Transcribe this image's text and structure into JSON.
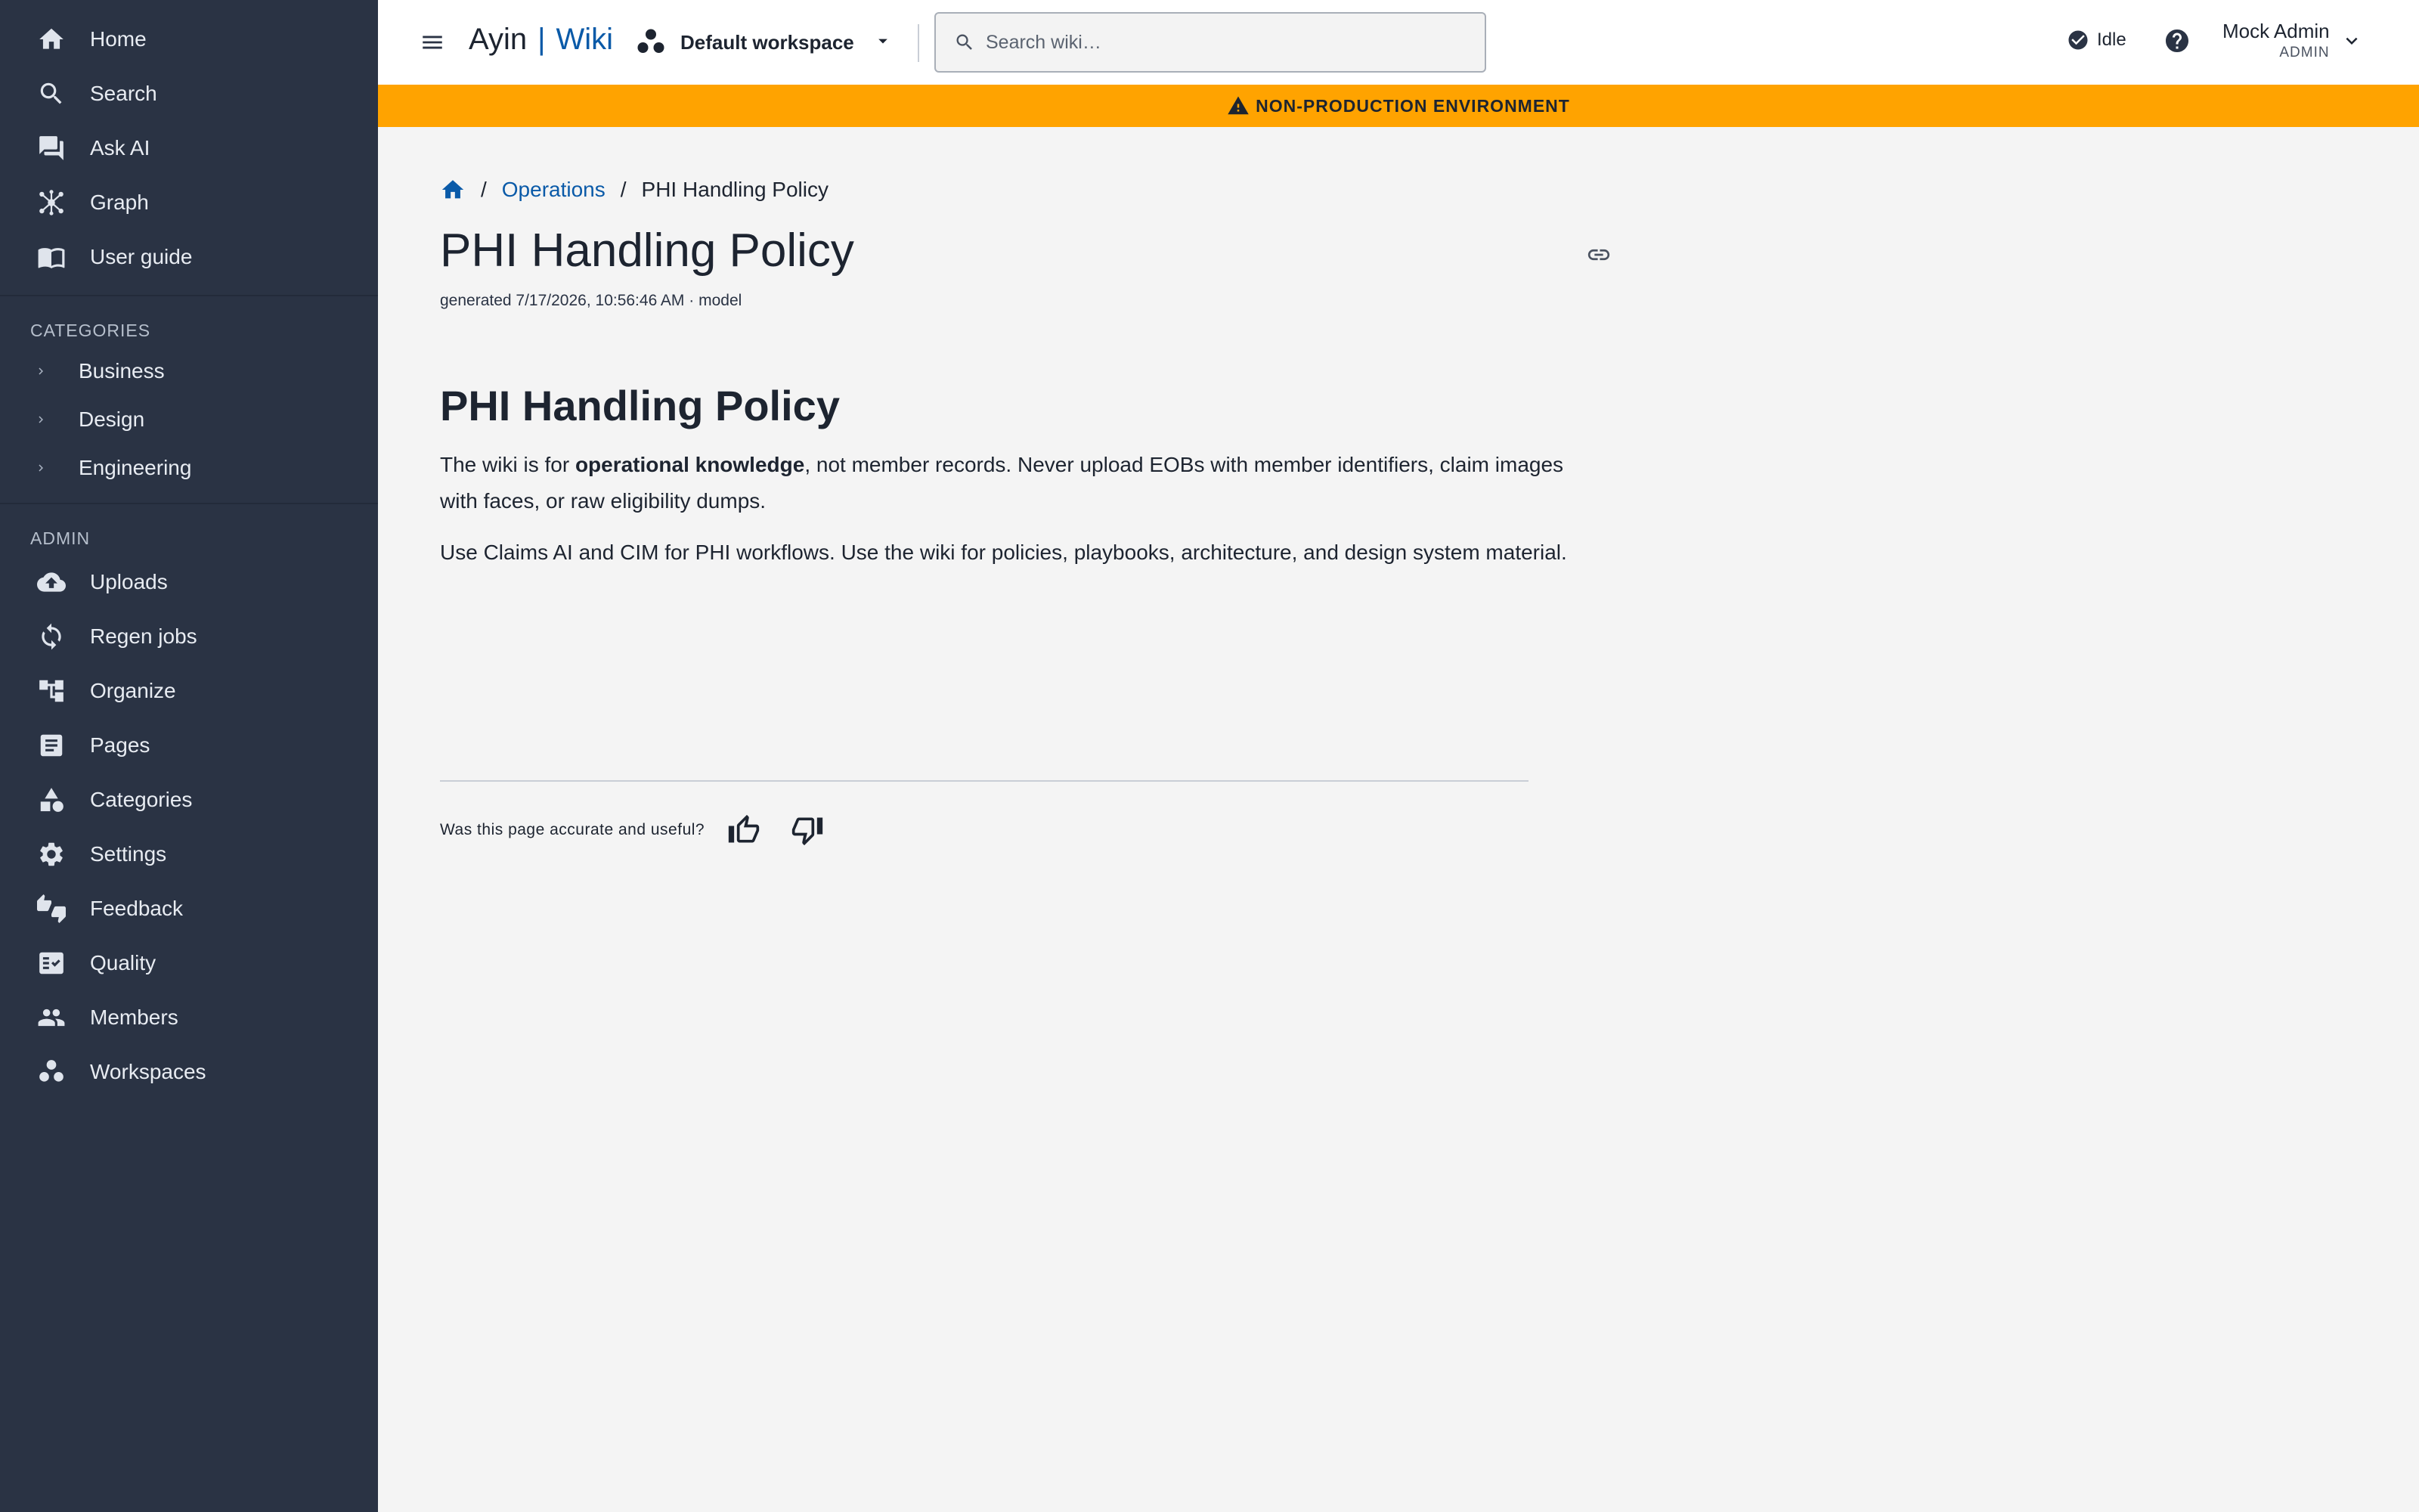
{
  "sidebar": {
    "top_items": [
      {
        "label": "Home",
        "icon": "home-icon"
      },
      {
        "label": "Search",
        "icon": "search-icon"
      },
      {
        "label": "Ask AI",
        "icon": "chat-icon"
      },
      {
        "label": "Graph",
        "icon": "graph-icon"
      },
      {
        "label": "User guide",
        "icon": "book-icon"
      }
    ],
    "categories_title": "CATEGORIES",
    "categories": [
      {
        "label": "Business"
      },
      {
        "label": "Design"
      },
      {
        "label": "Engineering"
      }
    ],
    "admin_title": "ADMIN",
    "admin_items": [
      {
        "label": "Uploads",
        "icon": "cloud-upload-icon"
      },
      {
        "label": "Regen jobs",
        "icon": "sync-icon"
      },
      {
        "label": "Organize",
        "icon": "tree-icon"
      },
      {
        "label": "Pages",
        "icon": "article-icon"
      },
      {
        "label": "Categories",
        "icon": "category-icon"
      },
      {
        "label": "Settings",
        "icon": "gear-icon"
      },
      {
        "label": "Feedback",
        "icon": "thumbs-updown-icon"
      },
      {
        "label": "Quality",
        "icon": "fact-check-icon"
      },
      {
        "label": "Members",
        "icon": "people-icon"
      },
      {
        "label": "Workspaces",
        "icon": "workspaces-icon"
      }
    ]
  },
  "header": {
    "brand_left": "Ayin",
    "brand_sep": "|",
    "brand_right": "Wiki",
    "workspace": "Default workspace",
    "search_placeholder": "Search wiki…",
    "status": "Idle",
    "user_name": "Mock Admin",
    "user_role": "ADMIN"
  },
  "banner": {
    "text": "NON-PRODUCTION ENVIRONMENT",
    "color": "#ffa300"
  },
  "breadcrumb": {
    "sep": "/",
    "parent": "Operations",
    "current": "PHI Handling Policy"
  },
  "page": {
    "title": "PHI Handling Policy",
    "meta": "generated 7/17/2026, 10:56:46 AM · model",
    "heading": "PHI Handling Policy",
    "p1_before": "The wiki is for ",
    "p1_bold": "operational knowledge",
    "p1_after": ", not member records. Never upload EOBs with member identifiers, claim images with faces, or raw eligibility dumps.",
    "p2": "Use Claims AI and CIM for PHI workflows. Use the wiki for policies, playbooks, architecture, and design system material."
  },
  "feedback": {
    "question": "Was this page accurate and useful?"
  },
  "colors": {
    "sidebar_bg": "#2a3344",
    "accent": "#0a5aa8",
    "page_bg": "#f4f4f4"
  }
}
